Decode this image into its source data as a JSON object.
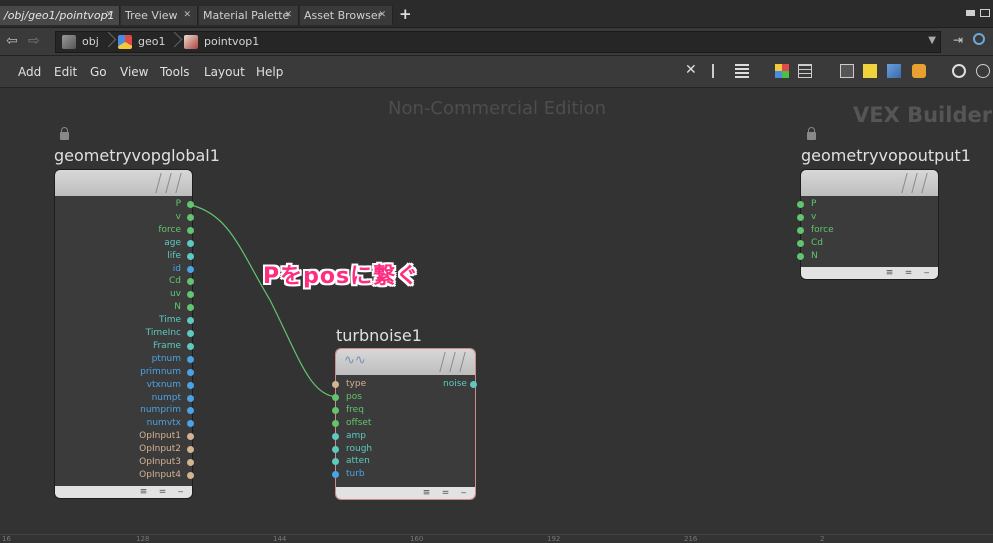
{
  "tabs": [
    {
      "label": "/obj/geo1/pointvop1",
      "active": true
    },
    {
      "label": "Tree View",
      "active": false
    },
    {
      "label": "Material Palette",
      "active": false
    },
    {
      "label": "Asset Browser",
      "active": false
    }
  ],
  "path": {
    "crumbs": [
      "obj",
      "geo1",
      "pointvop1"
    ]
  },
  "menu": [
    "Add",
    "Edit",
    "Go",
    "View",
    "Tools",
    "Layout",
    "Help"
  ],
  "canvas": {
    "watermark": "Non-Commercial Edition",
    "context_label": "VEX Builder"
  },
  "nodes": {
    "global": {
      "name": "geometryvopglobal1",
      "outputs": [
        {
          "label": "P",
          "color": "#62c46e"
        },
        {
          "label": "v",
          "color": "#62c46e"
        },
        {
          "label": "force",
          "color": "#62c46e"
        },
        {
          "label": "age",
          "color": "#5ec9c0"
        },
        {
          "label": "life",
          "color": "#5ec9c0"
        },
        {
          "label": "id",
          "color": "#4aa3e6"
        },
        {
          "label": "Cd",
          "color": "#62c46e"
        },
        {
          "label": "uv",
          "color": "#62c46e"
        },
        {
          "label": "N",
          "color": "#62c46e"
        },
        {
          "label": "Time",
          "color": "#5ec9c0"
        },
        {
          "label": "TimeInc",
          "color": "#5ec9c0"
        },
        {
          "label": "Frame",
          "color": "#5ec9c0"
        },
        {
          "label": "ptnum",
          "color": "#4aa3e6"
        },
        {
          "label": "primnum",
          "color": "#4aa3e6"
        },
        {
          "label": "vtxnum",
          "color": "#4aa3e6"
        },
        {
          "label": "numpt",
          "color": "#4aa3e6"
        },
        {
          "label": "numprim",
          "color": "#4aa3e6"
        },
        {
          "label": "numvtx",
          "color": "#4aa3e6"
        },
        {
          "label": "OpInput1",
          "color": "#d4b393"
        },
        {
          "label": "OpInput2",
          "color": "#d4b393"
        },
        {
          "label": "OpInput3",
          "color": "#d4b393"
        },
        {
          "label": "OpInput4",
          "color": "#d4b393"
        }
      ]
    },
    "output": {
      "name": "geometryvopoutput1",
      "inputs": [
        {
          "label": "P",
          "color": "#62c46e"
        },
        {
          "label": "v",
          "color": "#62c46e"
        },
        {
          "label": "force",
          "color": "#62c46e"
        },
        {
          "label": "Cd",
          "color": "#62c46e"
        },
        {
          "label": "N",
          "color": "#62c46e"
        }
      ]
    },
    "turbnoise": {
      "name": "turbnoise1",
      "inputs": [
        {
          "label": "type",
          "color": "#d4b393"
        },
        {
          "label": "pos",
          "color": "#62c46e"
        },
        {
          "label": "freq",
          "color": "#62c46e"
        },
        {
          "label": "offset",
          "color": "#62c46e"
        },
        {
          "label": "amp",
          "color": "#5ec9c0"
        },
        {
          "label": "rough",
          "color": "#5ec9c0"
        },
        {
          "label": "atten",
          "color": "#5ec9c0"
        },
        {
          "label": "turb",
          "color": "#4aa3e6"
        }
      ],
      "output_label": "noise",
      "output_color": "#5ec9c0"
    }
  },
  "annotation": "Pをposに繋ぐ",
  "ruler_ticks": [
    "16",
    "128",
    "144",
    "160",
    "192",
    "216",
    "2"
  ]
}
